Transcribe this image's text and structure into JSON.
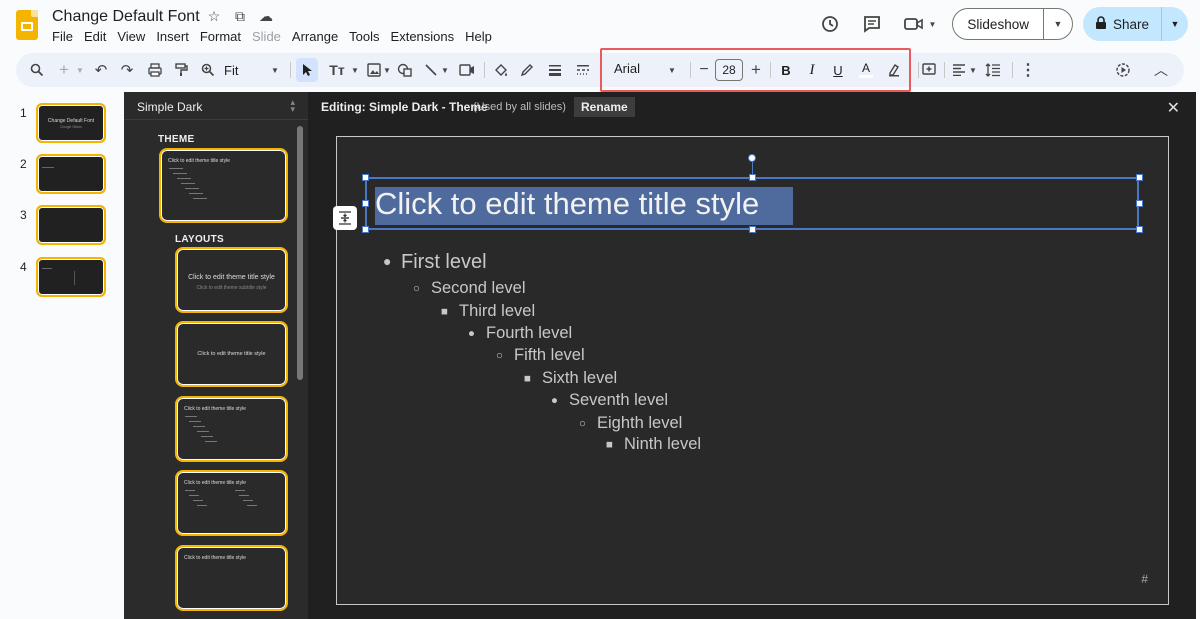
{
  "app": {
    "doc_title": "Change Default Font",
    "menu": [
      "File",
      "Edit",
      "View",
      "Insert",
      "Format",
      "Slide",
      "Arrange",
      "Tools",
      "Extensions",
      "Help"
    ],
    "slideshow_label": "Slideshow",
    "share_label": "Share"
  },
  "toolbar": {
    "zoom": "Fit",
    "font_name": "Arial",
    "font_size": "28",
    "bold": "B",
    "italic": "I",
    "underline": "U",
    "text_color": "A",
    "highlight_color": "#ea5a5a"
  },
  "filmstrip": {
    "slides": [
      {
        "num": "1",
        "title": "Change Default Font",
        "subtitle": "Google Slides"
      },
      {
        "num": "2",
        "title": "",
        "subtitle": ""
      },
      {
        "num": "3",
        "title": "",
        "subtitle": ""
      },
      {
        "num": "4",
        "title": "",
        "subtitle": ""
      }
    ]
  },
  "theme_panel": {
    "theme_name": "Simple Dark",
    "theme_label": "THEME",
    "layouts_label": "LAYOUTS",
    "theme_thumb_title": "Click to edit theme title style",
    "layout1_title": "Click to edit theme title style",
    "layout1_subtitle": "Click to edit theme subtitle style",
    "layout2_title": "Click to edit theme title style",
    "layout3_title": "Click to edit theme title style",
    "layout4_title": "Click to edit theme title style",
    "layout5_title": "Click to edit theme title style"
  },
  "editor": {
    "editing_label": "Editing: Simple Dark - Theme",
    "used_label": "(Used by all slides)",
    "rename_label": "Rename",
    "title_text": "Click to edit theme title style",
    "levels": [
      {
        "bullet": "●",
        "text": "First level"
      },
      {
        "bullet": "○",
        "text": "Second level"
      },
      {
        "bullet": "■",
        "text": "Third level"
      },
      {
        "bullet": "●",
        "text": "Fourth level"
      },
      {
        "bullet": "○",
        "text": "Fifth level"
      },
      {
        "bullet": "■",
        "text": "Sixth level"
      },
      {
        "bullet": "●",
        "text": "Seventh level"
      },
      {
        "bullet": "○",
        "text": "Eighth level"
      },
      {
        "bullet": "■",
        "text": "Ninth level"
      }
    ],
    "page_number": "#"
  },
  "colors": {
    "accent_yellow": "#f4b400",
    "selection_blue": "#4a78c2",
    "dark_bg": "#202020"
  }
}
